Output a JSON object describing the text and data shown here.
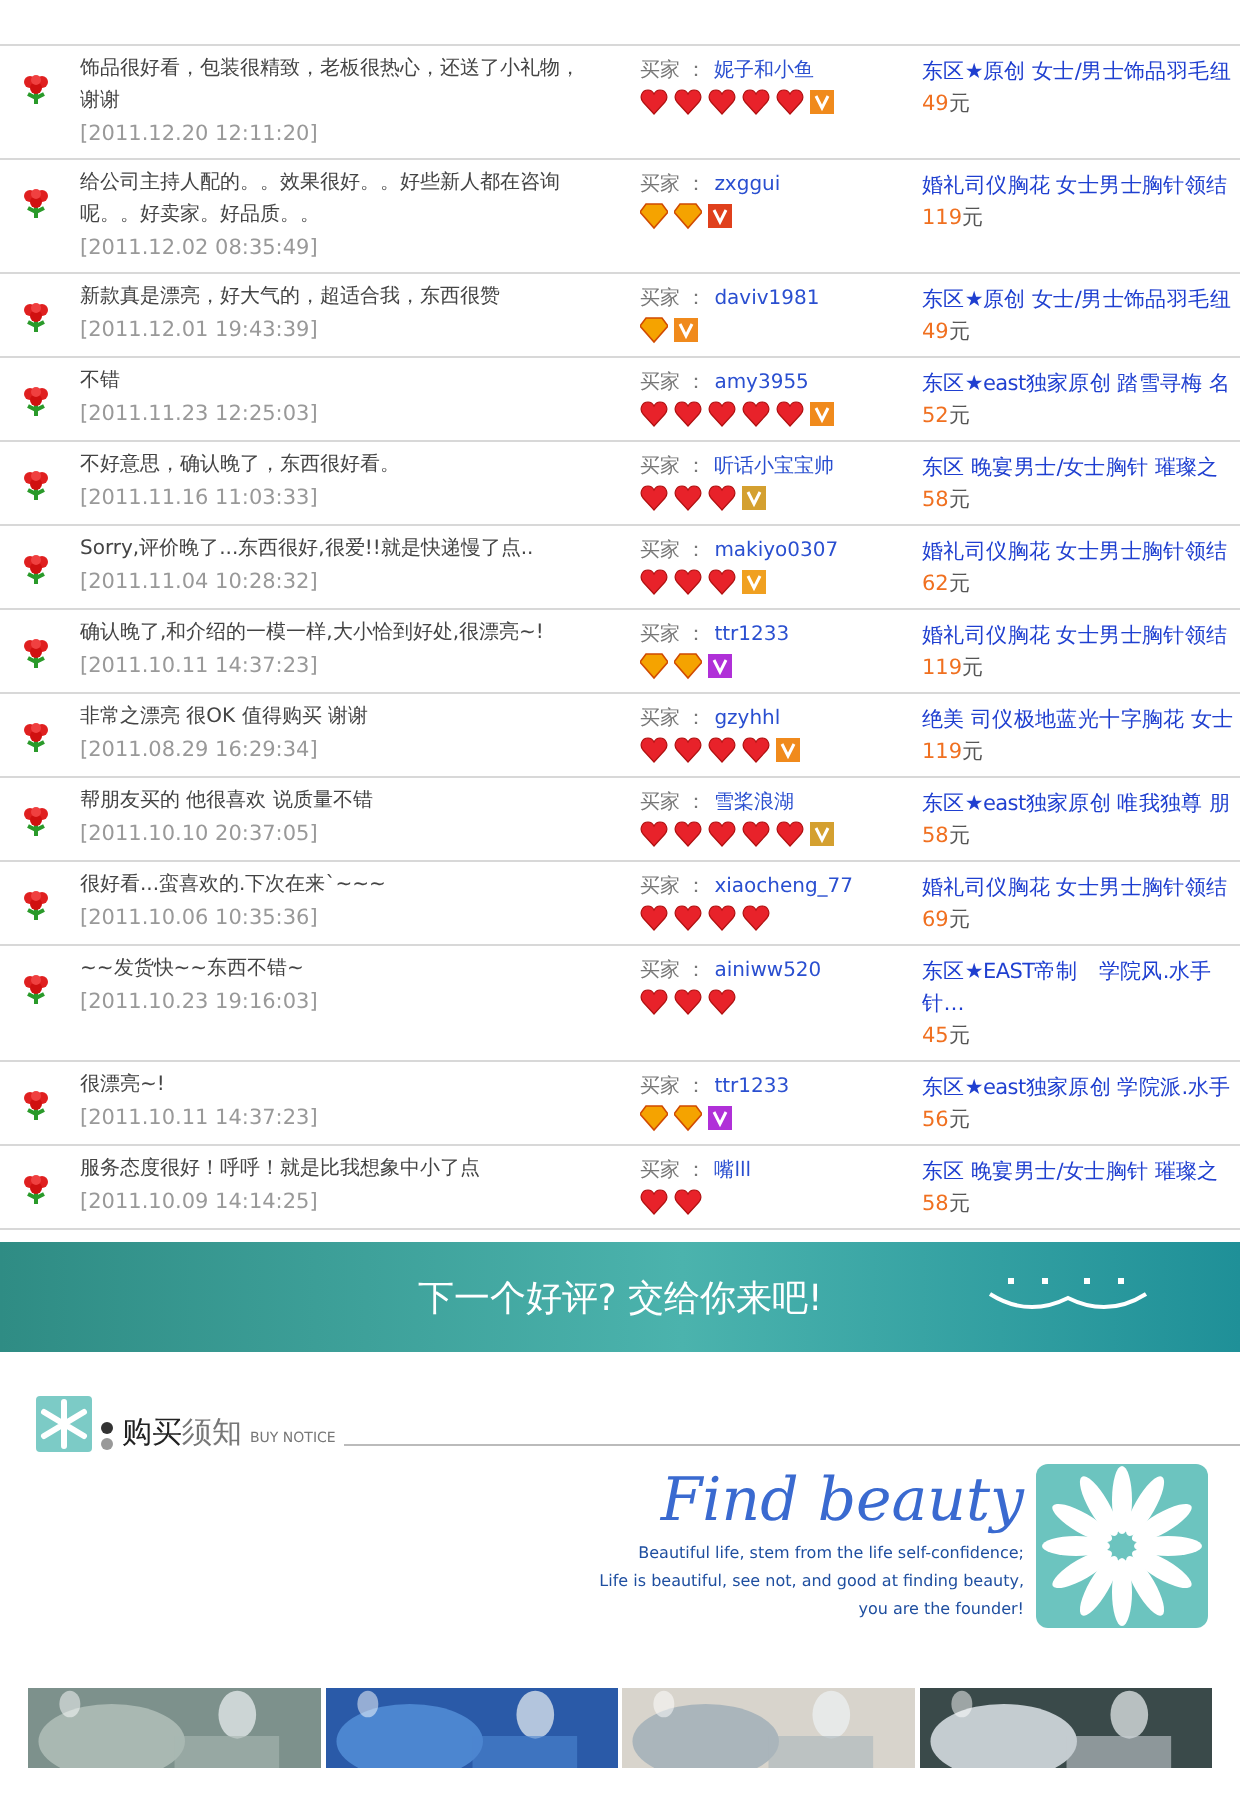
{
  "reviews": [
    {
      "comment": "饰品很好看，包装很精致，老板很热心，还送了小礼物，谢谢",
      "time": "[2011.12.20 12:11:20]",
      "buyer_label": "买家 ：",
      "buyer": "妮子和小鱼",
      "rank": [
        {
          "kind": "heart"
        },
        {
          "kind": "heart"
        },
        {
          "kind": "heart"
        },
        {
          "kind": "heart"
        },
        {
          "kind": "heart"
        }
      ],
      "badge": {
        "color": "#f08a1c"
      },
      "product": [
        "东区★原创 女士/男士饰品羽毛纽"
      ],
      "price": "49",
      "unit": "元"
    },
    {
      "comment": "给公司主持人配的。。效果很好。。好些新人都在咨询呢。。好卖家。好品质。。",
      "time": "[2011.12.02 08:35:49]",
      "buyer_label": "买家 ：",
      "buyer": "zxggui",
      "rank": [
        {
          "kind": "diamond"
        },
        {
          "kind": "diamond"
        }
      ],
      "badge": {
        "color": "#e0401c"
      },
      "product": [
        "婚礼司仪胸花 女士男士胸针领结"
      ],
      "price": "119",
      "unit": "元"
    },
    {
      "comment": "新款真是漂亮，好大气的，超适合我，东西很赞",
      "time": "[2011.12.01 19:43:39]",
      "buyer_label": "买家 ：",
      "buyer": "daviv1981",
      "rank": [
        {
          "kind": "diamond"
        }
      ],
      "badge": {
        "color": "#f08a1c"
      },
      "product": [
        "东区★原创 女士/男士饰品羽毛纽"
      ],
      "price": "49",
      "unit": "元"
    },
    {
      "comment": "不错",
      "time": "[2011.11.23 12:25:03]",
      "buyer_label": "买家 ：",
      "buyer": "amy3955",
      "rank": [
        {
          "kind": "heart"
        },
        {
          "kind": "heart"
        },
        {
          "kind": "heart"
        },
        {
          "kind": "heart"
        },
        {
          "kind": "heart"
        }
      ],
      "badge": {
        "color": "#f08a1c"
      },
      "product": [
        "东区★east独家原创 踏雪寻梅 名"
      ],
      "price": "52",
      "unit": "元"
    },
    {
      "comment": "不好意思，确认晚了，东西很好看。",
      "time": "[2011.11.16 11:03:33]",
      "buyer_label": "买家 ：",
      "buyer": "听话小宝宝帅",
      "rank": [
        {
          "kind": "heart"
        },
        {
          "kind": "heart"
        },
        {
          "kind": "heart"
        }
      ],
      "badge": {
        "color": "#d4a030"
      },
      "product": [
        "东区 晚宴男士/女士胸针 璀璨之"
      ],
      "price": "58",
      "unit": "元"
    },
    {
      "comment": "Sorry,评价晚了...东西很好,很爱!!就是快递慢了点..",
      "time": "[2011.11.04 10:28:32]",
      "buyer_label": "买家 ：",
      "buyer": "makiyo0307",
      "rank": [
        {
          "kind": "heart"
        },
        {
          "kind": "heart"
        },
        {
          "kind": "heart"
        }
      ],
      "badge": {
        "color": "#f0a020"
      },
      "product": [
        "婚礼司仪胸花 女士男士胸针领结"
      ],
      "price": "62",
      "unit": "元"
    },
    {
      "comment": "确认晚了,和介绍的一模一样,大小恰到好处,很漂亮~!",
      "time": "[2011.10.11 14:37:23]",
      "buyer_label": "买家 ：",
      "buyer": "ttr1233",
      "rank": [
        {
          "kind": "diamond"
        },
        {
          "kind": "diamond"
        }
      ],
      "badge": {
        "color": "#b030d8"
      },
      "product": [
        "婚礼司仪胸花 女士男士胸针领结"
      ],
      "price": "119",
      "unit": "元"
    },
    {
      "comment": "非常之漂亮 很OK 值得购买 谢谢",
      "time": "[2011.08.29 16:29:34]",
      "buyer_label": "买家 ：",
      "buyer": "gzyhhl",
      "rank": [
        {
          "kind": "heart"
        },
        {
          "kind": "heart"
        },
        {
          "kind": "heart"
        },
        {
          "kind": "heart"
        }
      ],
      "badge": {
        "color": "#f08a1c"
      },
      "product": [
        "绝美 司仪极地蓝光十字胸花 女士"
      ],
      "price": "119",
      "unit": "元"
    },
    {
      "comment": "帮朋友买的 他很喜欢 说质量不错",
      "time": "[2011.10.10 20:37:05]",
      "buyer_label": "买家 ：",
      "buyer": "雪桨浪湖",
      "rank": [
        {
          "kind": "heart"
        },
        {
          "kind": "heart"
        },
        {
          "kind": "heart"
        },
        {
          "kind": "heart"
        },
        {
          "kind": "heart"
        }
      ],
      "badge": {
        "color": "#d4a030"
      },
      "product": [
        "东区★east独家原创 唯我独尊 朋"
      ],
      "price": "58",
      "unit": "元"
    },
    {
      "comment": "很好看...蛮喜欢的.下次在来`~~~",
      "time": "[2011.10.06 10:35:36]",
      "buyer_label": "买家 ：",
      "buyer": "xiaocheng_77",
      "rank": [
        {
          "kind": "heart"
        },
        {
          "kind": "heart"
        },
        {
          "kind": "heart"
        },
        {
          "kind": "heart"
        }
      ],
      "product": [
        "婚礼司仪胸花 女士男士胸针领结"
      ],
      "price": "69",
      "unit": "元"
    },
    {
      "comment": "~~发货快~~东西不错~",
      "time": "[2011.10.23 19:16:03]",
      "buyer_label": "买家 ：",
      "buyer": "ainiww520",
      "rank": [
        {
          "kind": "heart"
        },
        {
          "kind": "heart"
        },
        {
          "kind": "heart"
        }
      ],
      "product": [
        "东区★EAST帝制　学院风.水手",
        "针…"
      ],
      "price": "45",
      "unit": "元"
    },
    {
      "comment": "很漂亮~!",
      "time": "[2011.10.11 14:37:23]",
      "buyer_label": "买家 ：",
      "buyer": "ttr1233",
      "rank": [
        {
          "kind": "diamond"
        },
        {
          "kind": "diamond"
        }
      ],
      "badge": {
        "color": "#b030d8"
      },
      "product": [
        "东区★east独家原创 学院派.水手"
      ],
      "price": "56",
      "unit": "元"
    },
    {
      "comment": "服务态度很好！呼呼！就是比我想象中小了点",
      "time": "[2011.10.09 14:14:25]",
      "buyer_label": "买家 ：",
      "buyer": "嘴lll",
      "rank": [
        {
          "kind": "heart"
        },
        {
          "kind": "heart"
        }
      ],
      "product": [
        "东区 晚宴男士/女士胸针 璀璨之"
      ],
      "price": "58",
      "unit": "元"
    }
  ],
  "banner": {
    "text": "下一个好评? 交给你来吧!"
  },
  "notice": {
    "title_bold": "购买",
    "title_light": "须知",
    "subtitle": "BUY NOTICE"
  },
  "slogan": {
    "headline": "Find beauty",
    "lines": [
      "Beautiful life, stem from the life self-confidence;",
      "Life is beautiful, see not, and good at finding beauty,",
      "you are the founder!"
    ]
  }
}
